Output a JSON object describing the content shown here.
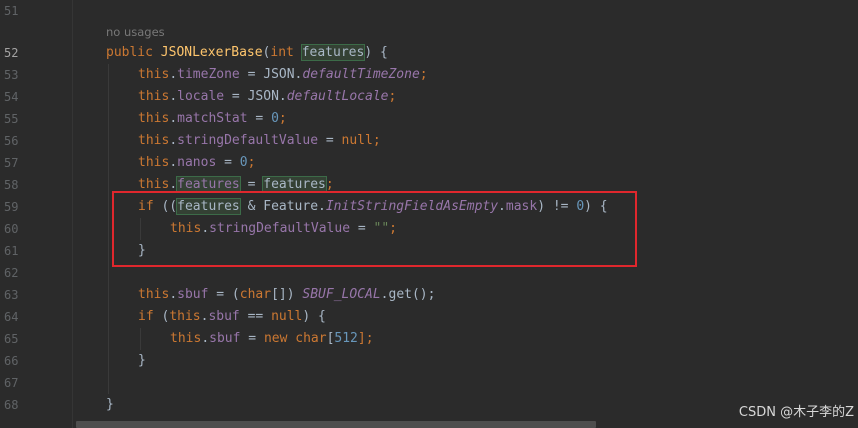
{
  "line_numbers": [
    "51",
    "52",
    "53",
    "54",
    "55",
    "56",
    "57",
    "58",
    "59",
    "60",
    "61",
    "62",
    "63",
    "64",
    "65",
    "66",
    "67",
    "68"
  ],
  "current_line": "52",
  "usage_hint": "no usages",
  "code": {
    "l52": {
      "kw_public": "public",
      "name": "JSONLexerBase",
      "open": "(",
      "kw_int": "int",
      "param": "features",
      "close": ") {"
    },
    "l53": {
      "this": "this",
      "dot": ".",
      "field": "timeZone",
      "eq": " = JSON.",
      "value": "defaultTimeZone",
      "semi": ";"
    },
    "l54": {
      "this": "this",
      "dot": ".",
      "field": "locale",
      "eq": " = JSON.",
      "value": "defaultLocale",
      "semi": ";"
    },
    "l55": {
      "this": "this",
      "dot": ".",
      "field": "matchStat",
      "eq": " = ",
      "value": "0",
      "semi": ";"
    },
    "l56": {
      "this": "this",
      "dot": ".",
      "field": "stringDefaultValue",
      "eq": " = ",
      "value": "null",
      "semi": ";"
    },
    "l57": {
      "this": "this",
      "dot": ".",
      "field": "nanos",
      "eq": " = ",
      "value": "0",
      "semi": ";"
    },
    "l58": {
      "this": "this",
      "dot": ".",
      "field": "features",
      "eq": " = ",
      "value": "features",
      "semi": ";"
    },
    "l59": {
      "kw_if": "if",
      "open": " ((",
      "param": "features",
      "amp": " & Feature.",
      "const": "InitStringFieldAsEmpty",
      "dot": ".",
      "mask": "mask",
      "ne": ") != ",
      "zero": "0",
      "brace": ") {"
    },
    "l60": {
      "this": "this",
      "dot": ".",
      "field": "stringDefaultValue",
      "eq": " = ",
      "value": "\"\"",
      "semi": ";"
    },
    "l61": {
      "brace": "}"
    },
    "l63": {
      "this": "this",
      "dot": ".",
      "field": "sbuf",
      "eq": " = (",
      "kw_char": "char",
      "arr": "[]) ",
      "const": "SBUF_LOCAL",
      "get": ".get();"
    },
    "l64": {
      "kw_if": "if",
      "open": " (",
      "this": "this",
      "dot": ".",
      "field": "sbuf",
      "eq": " == ",
      "null": "null",
      "brace": ") {"
    },
    "l65": {
      "this": "this",
      "dot": ".",
      "field": "sbuf",
      "eq": " = ",
      "kw_new": "new",
      "sp": " ",
      "kw_char": "char",
      "bracket_open": "[",
      "num": "512",
      "bracket_close": "];"
    },
    "l66": {
      "brace": "}"
    },
    "l68": {
      "brace": "}"
    }
  },
  "watermark": "CSDN @木子李的Z",
  "colors": {
    "background": "#2b2b2b",
    "keyword": "#cc7832",
    "method_name": "#ffc66d",
    "field": "#9876aa",
    "number": "#6897bb",
    "string": "#6a8759",
    "highlight_box": "#e0272d"
  }
}
